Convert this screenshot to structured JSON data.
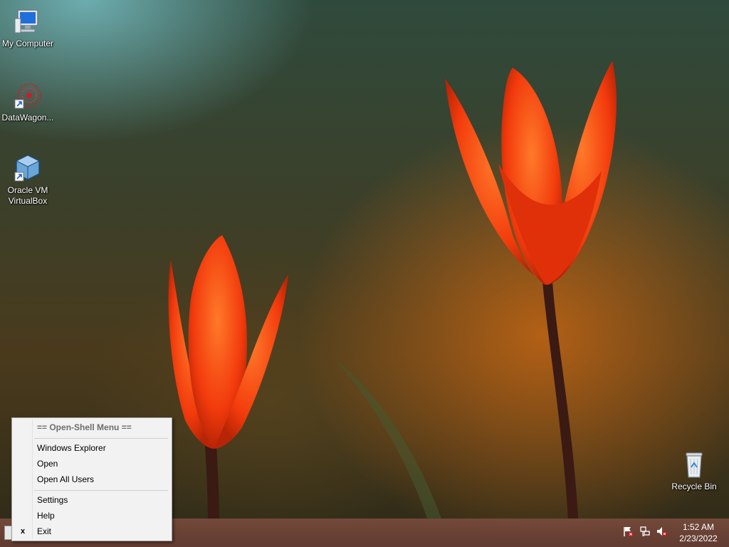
{
  "desktop": {
    "icons": [
      {
        "label": "My Computer",
        "icon": "computer-icon"
      },
      {
        "label": "DataWagon...",
        "icon": "datawagon-shortcut-icon"
      },
      {
        "label_line1": "Oracle VM",
        "label_line2": "VirtualBox",
        "icon": "virtualbox-shortcut-icon"
      },
      {
        "label": "Recycle Bin",
        "icon": "recycle-bin-icon"
      }
    ]
  },
  "context_menu": {
    "header": "== Open-Shell Menu ==",
    "items": [
      {
        "label": "Windows Explorer"
      },
      {
        "label": "Open"
      },
      {
        "label": "Open All Users"
      },
      {
        "label": "Settings"
      },
      {
        "label": "Help"
      },
      {
        "label": "Exit",
        "mark": "x"
      }
    ]
  },
  "taskbar": {
    "clock": {
      "time": "1:52 AM",
      "date": "2/23/2022"
    },
    "tray_icons": [
      "action-center-flag-icon",
      "network-icon",
      "volume-muted-icon"
    ]
  },
  "colors": {
    "taskbar": "#6e4236",
    "menu_bg": "#f2f2f2",
    "flower": "#ff4a10"
  }
}
